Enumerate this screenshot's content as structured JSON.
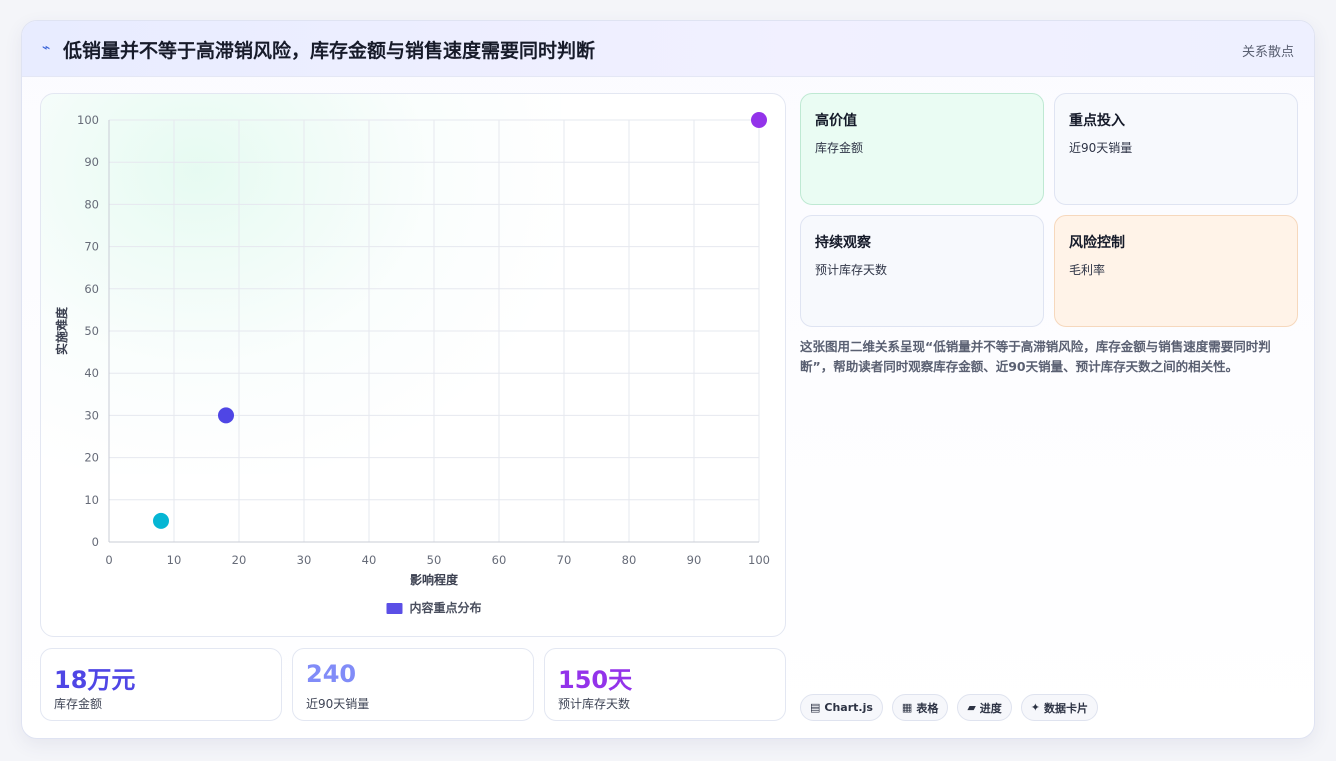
{
  "header": {
    "title": "低销量并不等于高滞销风险，库存金额与销售速度需要同时判断",
    "tag": "关系散点"
  },
  "chart_data": {
    "type": "scatter",
    "xlabel": "影响程度",
    "ylabel": "实施难度",
    "xlim": [
      0,
      100
    ],
    "ylim": [
      0,
      100
    ],
    "x_ticks": [
      "0",
      "10",
      "20",
      "30",
      "40",
      "50",
      "60",
      "70",
      "80",
      "90",
      "100"
    ],
    "y_ticks": [
      "0",
      "10",
      "20",
      "30",
      "40",
      "50",
      "60",
      "70",
      "80",
      "90",
      "100"
    ],
    "grid": true,
    "legend_position": "bottom",
    "series": [
      {
        "name": "内容重点分布",
        "points": [
          {
            "x": 8,
            "y": 5,
            "color": "#06b6d4"
          },
          {
            "x": 18,
            "y": 30,
            "color": "#4f46e5"
          },
          {
            "x": 100,
            "y": 100,
            "color": "#9333ea"
          }
        ]
      }
    ],
    "legend_color": "#5b4fe6"
  },
  "stats": [
    {
      "value": "18万元",
      "label": "库存金额",
      "color": "#4f46e5"
    },
    {
      "value": "240",
      "label": "近90天销量",
      "color": "#818cf8"
    },
    {
      "value": "150天",
      "label": "预计库存天数",
      "color": "#9333ea"
    }
  ],
  "quadrants": [
    {
      "title": "高价值",
      "sub": "库存金额",
      "bg": "#eafcf3",
      "border": "#bfe9d3"
    },
    {
      "title": "重点投入",
      "sub": "近90天销量",
      "bg": "#f7f9fd",
      "border": "#dfe4f2"
    },
    {
      "title": "持续观察",
      "sub": "预计库存天数",
      "bg": "#f7f9fd",
      "border": "#dfe4f2"
    },
    {
      "title": "风险控制",
      "sub": "毛利率",
      "bg": "#fff3e8",
      "border": "#f6d8bd"
    }
  ],
  "description": "这张图用二维关系呈现“低销量并不等于高滞销风险，库存金额与销售速度需要同时判断”，帮助读者同时观察库存金额、近90天销量、预计库存天数之间的相关性。",
  "chips": [
    {
      "icon": "chart-icon",
      "glyph": "▤",
      "label": "Chart.js"
    },
    {
      "icon": "table-icon",
      "glyph": "▦",
      "label": "表格"
    },
    {
      "icon": "progress-icon",
      "glyph": "▰",
      "label": "进度"
    },
    {
      "icon": "sparkle-icon",
      "glyph": "✦",
      "label": "数据卡片"
    }
  ]
}
